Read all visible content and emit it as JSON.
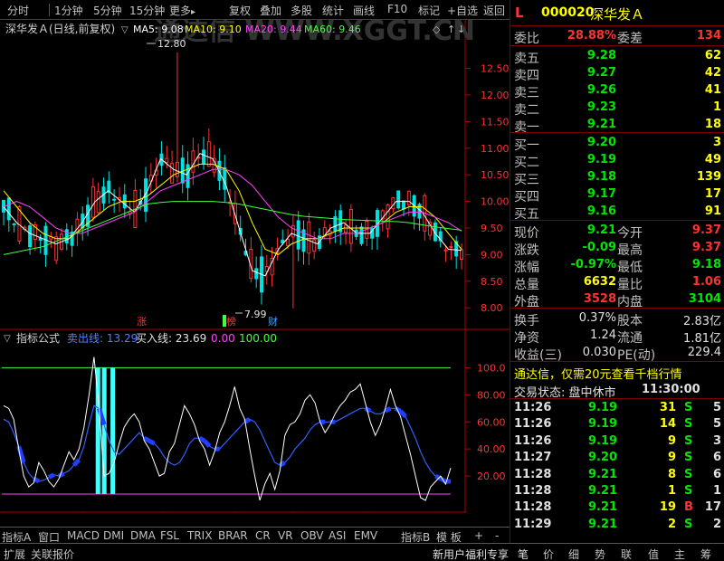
{
  "toolbar": {
    "periods": [
      "分时",
      "1分钟",
      "5分钟",
      "15分钟",
      "更多"
    ],
    "more_arrow": "▸",
    "actions": [
      "复权",
      "叠加",
      "多股",
      "统计",
      "画线",
      "F10",
      "标记",
      "+自选",
      "返回"
    ]
  },
  "chart": {
    "stock_label": "深华发Ａ(日线,前复权)",
    "ma5": "MA5: 9.08",
    "ma10": "MA10: 9.10",
    "ma20": "MA20: 9.44",
    "ma60": "MA60: 9.46",
    "watermark": "通达信 WWW.XGGT.CN",
    "price_axis": [
      "12.50",
      "12.00",
      "11.50",
      "11.00",
      "10.50",
      "10.00",
      "9.50",
      "9.00",
      "8.50",
      "8.00"
    ],
    "high_label": "12.80",
    "low_label": "7.99",
    "markers": {
      "zhang": "涨",
      "bang": "榜",
      "cai": "财"
    },
    "indicator_label": "指标公式",
    "sell_line": "卖出线: 13.29",
    "buy_line": "买入线: 23.69",
    "zero_line": "0.00",
    "hundred_line": "100.00",
    "ind_axis": [
      "100.0",
      "80.00",
      "60.00",
      "40.00",
      "20.00"
    ],
    "date_axis": [
      "2022年",
      "8",
      "9",
      "10",
      "11",
      "12",
      "1"
    ],
    "period_label": "日线"
  },
  "bottom_tabs": [
    "指标A",
    "窗口",
    "MACD",
    "DMI",
    "DMA",
    "FSL",
    "TRIX",
    "BRAR",
    "CR",
    "VR",
    "OBV",
    "ASI",
    "EMV",
    "指标B",
    "模 板",
    "+",
    "-"
  ],
  "statusbar": {
    "left": [
      "扩展",
      "关联报价"
    ],
    "promo": "新用户福利专享",
    "tabs": [
      "笔",
      "价",
      "细",
      "势",
      "联",
      "值",
      "主",
      "筹"
    ]
  },
  "quote": {
    "marker": "L",
    "code": "000020",
    "name": "深华发Ａ",
    "weibi_label": "委比",
    "weibi": "28.88%",
    "weicha_label": "委差",
    "weicha": "134",
    "sells": [
      {
        "label": "卖五",
        "price": "9.28",
        "vol": "62"
      },
      {
        "label": "卖四",
        "price": "9.27",
        "vol": "42"
      },
      {
        "label": "卖三",
        "price": "9.26",
        "vol": "41"
      },
      {
        "label": "卖二",
        "price": "9.23",
        "vol": "1"
      },
      {
        "label": "卖一",
        "price": "9.21",
        "vol": "18"
      }
    ],
    "buys": [
      {
        "label": "买一",
        "price": "9.20",
        "vol": "3"
      },
      {
        "label": "买二",
        "price": "9.19",
        "vol": "49"
      },
      {
        "label": "买三",
        "price": "9.18",
        "vol": "139"
      },
      {
        "label": "买四",
        "price": "9.17",
        "vol": "17"
      },
      {
        "label": "买五",
        "price": "9.16",
        "vol": "91"
      }
    ],
    "stats": [
      {
        "l1": "现价",
        "v1": "9.21",
        "c1": "green",
        "l2": "今开",
        "v2": "9.37",
        "c2": "red"
      },
      {
        "l1": "涨跌",
        "v1": "-0.09",
        "c1": "green",
        "l2": "最高",
        "v2": "9.37",
        "c2": "red"
      },
      {
        "l1": "涨幅",
        "v1": "-0.97%",
        "c1": "green",
        "l2": "最低",
        "v2": "9.18",
        "c2": "green"
      },
      {
        "l1": "总量",
        "v1": "6632",
        "c1": "yellow",
        "l2": "量比",
        "v2": "1.06",
        "c2": "red"
      },
      {
        "l1": "外盘",
        "v1": "3528",
        "c1": "red",
        "l2": "内盘",
        "v2": "3104",
        "c2": "green"
      }
    ],
    "stats2": [
      {
        "l1": "换手",
        "v1": "0.37%",
        "l2": "股本",
        "v2": "2.83亿"
      },
      {
        "l1": "净资",
        "v1": "1.24",
        "l2": "流通",
        "v2": "1.81亿"
      },
      {
        "l1": "收益(三)",
        "v1": "0.030",
        "l2": "PE(动)",
        "v2": "229.4"
      }
    ],
    "ad": "通达信，仅需20元查看千档行情",
    "trade_status_label": "交易状态: 盘中休市",
    "trade_status_time": "11:30:00",
    "ticks": [
      {
        "t": "11:26",
        "p": "9.19",
        "v": "31",
        "d": "S",
        "n": "5"
      },
      {
        "t": "11:26",
        "p": "9.19",
        "v": "14",
        "d": "S",
        "n": "5"
      },
      {
        "t": "11:26",
        "p": "9.19",
        "v": "9",
        "d": "S",
        "n": "3"
      },
      {
        "t": "11:27",
        "p": "9.20",
        "v": "9",
        "d": "S",
        "n": "6"
      },
      {
        "t": "11:28",
        "p": "9.21",
        "v": "8",
        "d": "S",
        "n": "6"
      },
      {
        "t": "11:28",
        "p": "9.21",
        "v": "1",
        "d": "S",
        "n": "1"
      },
      {
        "t": "11:28",
        "p": "9.21",
        "v": "19",
        "d": "B",
        "n": "17"
      },
      {
        "t": "11:29",
        "p": "9.21",
        "v": "2",
        "d": "S",
        "n": "2"
      }
    ]
  },
  "chart_data": {
    "type": "line",
    "title": "",
    "xlabel": "",
    "ylabel": "",
    "ylim": [
      7.8,
      12.9
    ],
    "x_ticks": [
      "2022年",
      "8",
      "9",
      "10",
      "11",
      "12",
      "1"
    ],
    "series": [
      {
        "name": "MA5",
        "color": "#ffffff",
        "values": [
          9.9,
          9.6,
          9.4,
          9.3,
          9.2,
          9.3,
          9.6,
          10.0,
          10.2,
          10.0,
          9.8,
          10.2,
          10.8,
          10.6,
          10.5,
          10.9,
          10.8,
          10.3,
          9.5,
          8.7,
          8.6,
          9.1,
          9.4,
          9.3,
          9.2,
          9.5,
          9.6,
          9.4,
          9.4,
          9.7,
          10.0,
          10.0,
          9.8,
          9.4,
          9.1,
          9.08
        ]
      },
      {
        "name": "MA10",
        "color": "#ffff00",
        "values": [
          10.2,
          9.9,
          9.6,
          9.4,
          9.3,
          9.3,
          9.5,
          9.7,
          9.9,
          10.0,
          10.0,
          10.1,
          10.3,
          10.5,
          10.6,
          10.7,
          10.7,
          10.6,
          10.2,
          9.6,
          9.1,
          9.0,
          9.2,
          9.3,
          9.3,
          9.4,
          9.5,
          9.5,
          9.5,
          9.6,
          9.8,
          9.9,
          9.9,
          9.7,
          9.4,
          9.1
        ]
      },
      {
        "name": "MA20",
        "color": "#ff40ff",
        "values": [
          9.9,
          10.0,
          9.9,
          9.7,
          9.5,
          9.4,
          9.4,
          9.5,
          9.6,
          9.7,
          9.8,
          10.0,
          10.2,
          10.3,
          10.4,
          10.5,
          10.6,
          10.6,
          10.5,
          10.3,
          10.0,
          9.7,
          9.5,
          9.4,
          9.3,
          9.3,
          9.4,
          9.4,
          9.5,
          9.6,
          9.7,
          9.8,
          9.8,
          9.7,
          9.6,
          9.44
        ]
      },
      {
        "name": "MA60",
        "color": "#40ff40",
        "values": [
          9.0,
          9.05,
          9.1,
          9.15,
          9.25,
          9.35,
          9.45,
          9.55,
          9.65,
          9.75,
          9.85,
          9.95,
          9.98,
          10.0,
          10.0,
          10.0,
          10.0,
          9.98,
          9.95,
          9.9,
          9.85,
          9.8,
          9.75,
          9.72,
          9.7,
          9.68,
          9.66,
          9.65,
          9.64,
          9.63,
          9.62,
          9.6,
          9.56,
          9.52,
          9.49,
          9.46
        ]
      }
    ],
    "indicator": {
      "ylim": [
        0,
        115
      ],
      "lines": {
        "upper": 100,
        "lower": 0
      },
      "white": [
        72,
        70,
        62,
        40,
        20,
        12,
        15,
        30,
        24,
        16,
        12,
        18,
        28,
        38,
        32,
        40,
        56,
        80,
        108,
        70,
        20,
        22,
        30,
        44,
        56,
        62,
        66,
        60,
        46,
        40,
        30,
        20,
        22,
        38,
        44,
        58,
        72,
        66,
        58,
        46,
        40,
        28,
        38,
        52,
        60,
        72,
        86,
        70,
        62,
        40,
        20,
        2,
        14,
        22,
        10,
        24,
        50,
        58,
        60,
        66,
        76,
        80,
        74,
        60,
        52,
        58,
        66,
        72,
        76,
        82,
        84,
        88,
        74,
        60,
        50,
        58,
        70,
        84,
        72,
        64,
        50,
        36,
        20,
        4,
        2,
        12,
        16,
        20,
        14,
        26
      ],
      "blue": [
        62,
        60,
        52,
        42,
        30,
        22,
        18,
        16,
        17,
        19,
        21,
        20,
        22,
        24,
        28,
        32,
        42,
        58,
        72,
        70,
        58,
        46,
        38,
        36,
        40,
        44,
        48,
        52,
        48,
        46,
        44,
        40,
        34,
        30,
        28,
        30,
        36,
        44,
        48,
        48,
        46,
        42,
        40,
        40,
        44,
        48,
        52,
        56,
        60,
        62,
        60,
        54,
        46,
        38,
        30,
        28,
        30,
        34,
        40,
        44,
        48,
        54,
        58,
        60,
        60,
        60,
        60,
        62,
        64,
        66,
        68,
        70,
        70,
        68,
        66,
        66,
        68,
        70,
        70,
        68,
        64,
        56,
        48,
        38,
        30,
        24,
        20,
        18,
        16,
        16
      ],
      "cyan_bars_at": [
        19,
        20,
        21
      ]
    }
  }
}
